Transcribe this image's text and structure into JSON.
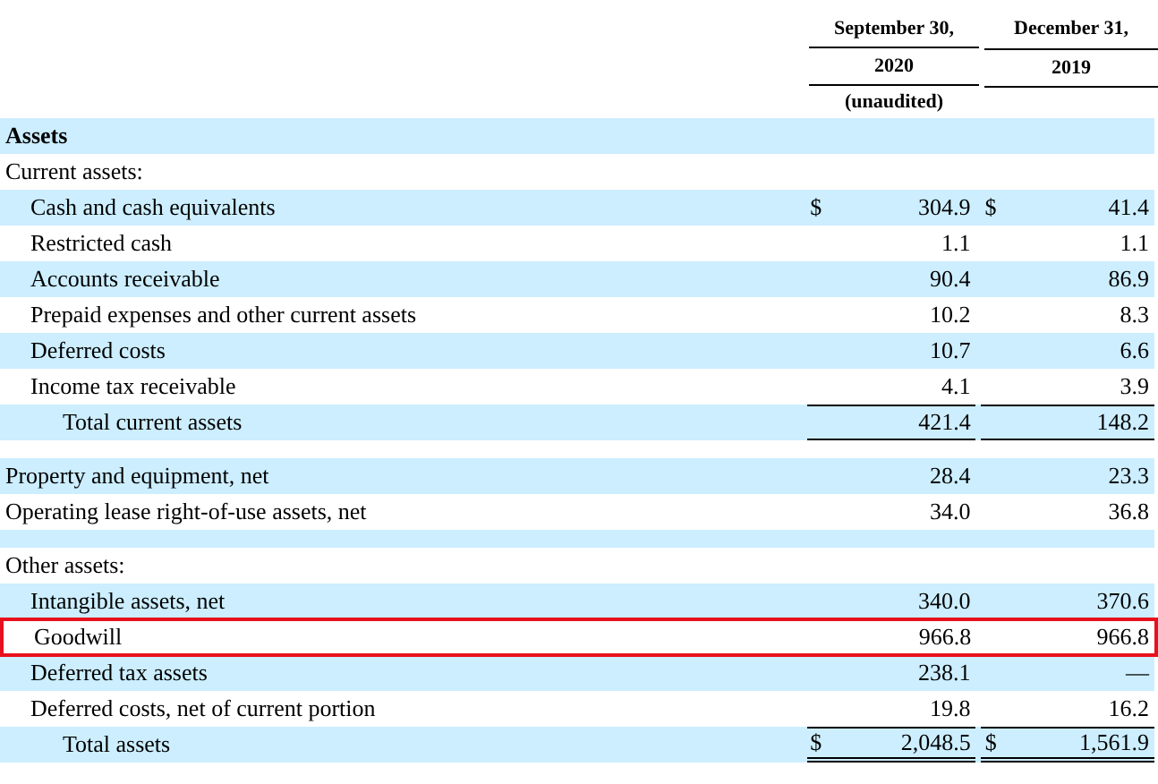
{
  "columns": [
    {
      "heading": "September 30,",
      "year": "2020",
      "note": "(unaudited)"
    },
    {
      "heading": "December 31,",
      "year": "2019"
    }
  ],
  "rows": [
    {
      "kind": "section",
      "label": "Assets",
      "shaded": true,
      "highlighted": false
    },
    {
      "kind": "group",
      "label": "Current assets:",
      "shaded": false,
      "highlighted": false
    },
    {
      "kind": "item",
      "label": "Cash and cash equivalents",
      "values": [
        {
          "currency": "$",
          "amount": "304.9"
        },
        {
          "currency": "$",
          "amount": "41.4"
        }
      ],
      "shaded": true,
      "highlighted": false
    },
    {
      "kind": "item",
      "label": "Restricted cash",
      "values": [
        {
          "amount": "1.1"
        },
        {
          "amount": "1.1"
        }
      ],
      "shaded": false,
      "highlighted": false
    },
    {
      "kind": "item",
      "label": "Accounts receivable",
      "values": [
        {
          "amount": "90.4"
        },
        {
          "amount": "86.9"
        }
      ],
      "shaded": true,
      "highlighted": false
    },
    {
      "kind": "item",
      "label": "Prepaid expenses and other current assets",
      "values": [
        {
          "amount": "10.2"
        },
        {
          "amount": "8.3"
        }
      ],
      "shaded": false,
      "highlighted": false
    },
    {
      "kind": "item",
      "label": "Deferred costs",
      "values": [
        {
          "amount": "10.7"
        },
        {
          "amount": "6.6"
        }
      ],
      "shaded": true,
      "highlighted": false
    },
    {
      "kind": "item",
      "label": "Income tax receivable",
      "values": [
        {
          "amount": "4.1"
        },
        {
          "amount": "3.9"
        }
      ],
      "shaded": false,
      "highlighted": false
    },
    {
      "kind": "subtotal",
      "label": "Total current assets",
      "values": [
        {
          "amount": "421.4"
        },
        {
          "amount": "148.2"
        }
      ],
      "shaded": true,
      "highlighted": false
    },
    {
      "kind": "spacer",
      "shaded": false,
      "highlighted": false
    },
    {
      "kind": "line",
      "label": "Property and equipment, net",
      "values": [
        {
          "amount": "28.4"
        },
        {
          "amount": "23.3"
        }
      ],
      "shaded": true,
      "highlighted": false
    },
    {
      "kind": "line",
      "label": "Operating lease right-of-use assets, net",
      "values": [
        {
          "amount": "34.0"
        },
        {
          "amount": "36.8"
        }
      ],
      "shaded": false,
      "highlighted": false
    },
    {
      "kind": "spacer",
      "shaded": true,
      "highlighted": false
    },
    {
      "kind": "group",
      "label": "Other assets:",
      "shaded": false,
      "highlighted": false
    },
    {
      "kind": "item",
      "label": "Intangible assets, net",
      "values": [
        {
          "amount": "340.0"
        },
        {
          "amount": "370.6"
        }
      ],
      "shaded": true,
      "highlighted": false
    },
    {
      "kind": "item",
      "label": "Goodwill",
      "values": [
        {
          "amount": "966.8"
        },
        {
          "amount": "966.8"
        }
      ],
      "shaded": false,
      "highlighted": true
    },
    {
      "kind": "item",
      "label": "Deferred tax assets",
      "values": [
        {
          "amount": "238.1"
        },
        {
          "amount": "—"
        }
      ],
      "shaded": true,
      "highlighted": false
    },
    {
      "kind": "item",
      "label": "Deferred costs, net of current portion",
      "values": [
        {
          "amount": "19.8"
        },
        {
          "amount": "16.2"
        }
      ],
      "shaded": false,
      "highlighted": false
    },
    {
      "kind": "total",
      "label": "Total assets",
      "values": [
        {
          "currency": "$",
          "amount": "2,048.5"
        },
        {
          "currency": "$",
          "amount": "1,561.9"
        }
      ],
      "shaded": true,
      "highlighted": false
    }
  ]
}
